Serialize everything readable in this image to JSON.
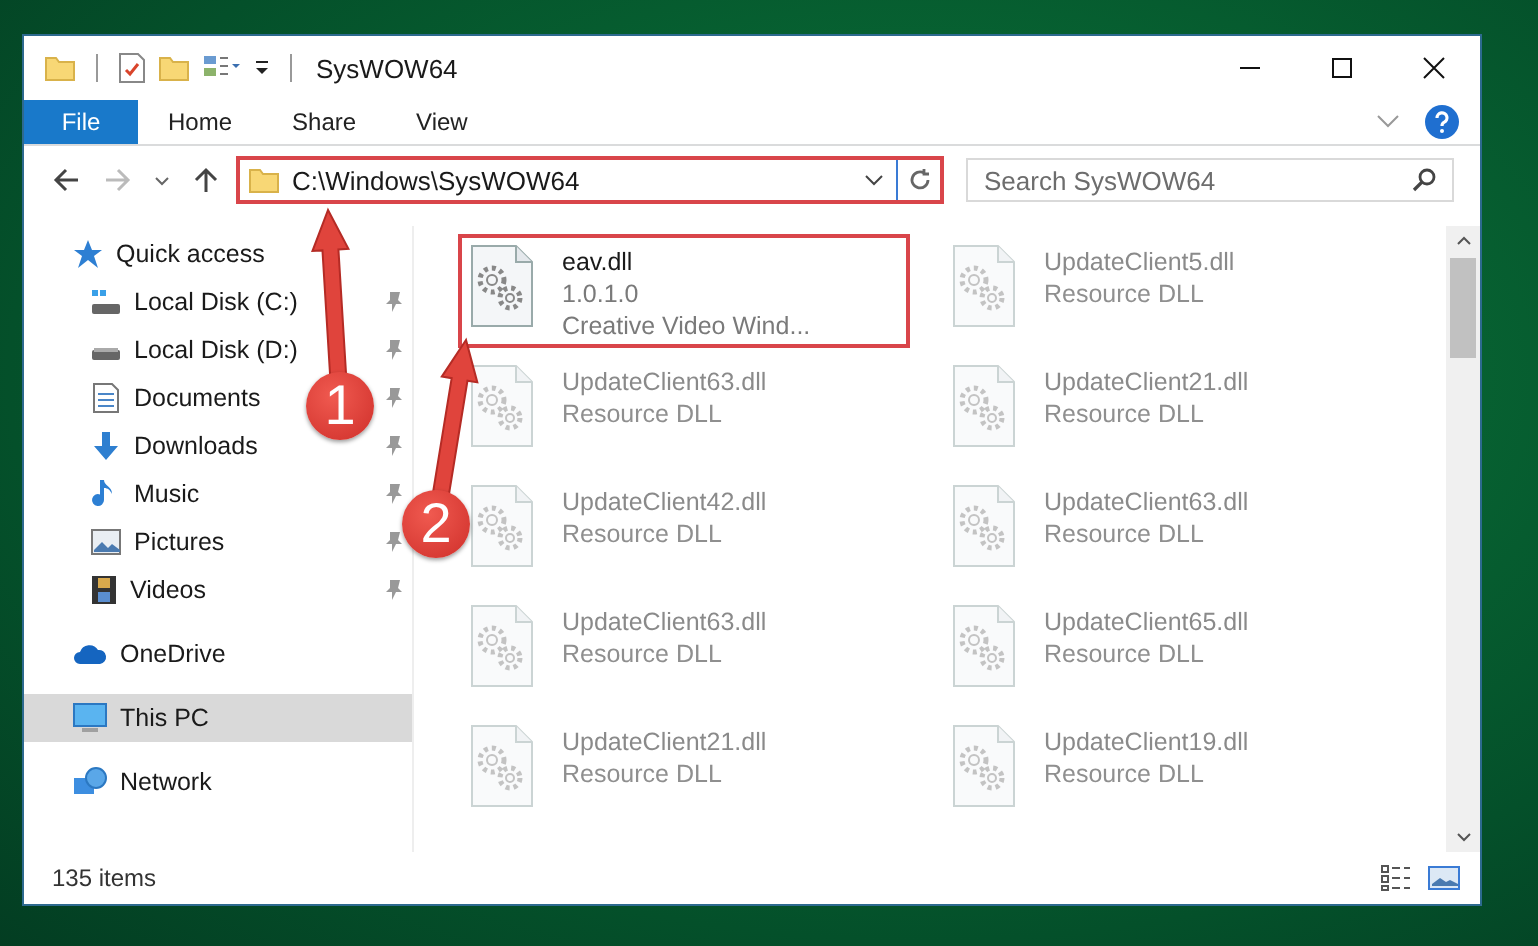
{
  "window": {
    "title": "SysWOW64"
  },
  "ribbon_tabs": [
    {
      "label": "File",
      "kind": "file"
    },
    {
      "label": "Home",
      "kind": "tab"
    },
    {
      "label": "Share",
      "kind": "tab"
    },
    {
      "label": "View",
      "kind": "tab"
    }
  ],
  "address_bar": {
    "path": "C:\\Windows\\SysWOW64",
    "highlighted": true
  },
  "search": {
    "placeholder": "Search SysWOW64"
  },
  "navigation": [
    {
      "label": "Quick access",
      "kind": "quick-access",
      "selected": false,
      "children": [
        {
          "label": "Local Disk (C:)",
          "kind": "system-drive",
          "pinned": true,
          "selected": false
        },
        {
          "label": "Local Disk (D:)",
          "kind": "drive",
          "pinned": true,
          "selected": false
        },
        {
          "label": "Documents",
          "kind": "documents",
          "pinned": true,
          "selected": false
        },
        {
          "label": "Downloads",
          "kind": "downloads",
          "pinned": true,
          "selected": false
        },
        {
          "label": "Music",
          "kind": "music",
          "pinned": true,
          "selected": false
        },
        {
          "label": "Pictures",
          "kind": "pictures",
          "pinned": true,
          "selected": false
        },
        {
          "label": "Videos",
          "kind": "videos",
          "pinned": true,
          "selected": false
        }
      ]
    },
    {
      "label": "OneDrive",
      "kind": "cloud",
      "selected": false
    },
    {
      "label": "This PC",
      "kind": "pc",
      "selected": true
    },
    {
      "label": "Network",
      "kind": "network",
      "selected": false
    }
  ],
  "files": [
    {
      "name": "eav.dll",
      "details": [
        "1.0.1.0",
        "Creative Video Wind..."
      ],
      "blurred": false,
      "highlighted": true
    },
    {
      "name": "UpdateClient5.dll",
      "details": [
        "Resource DLL"
      ],
      "blurred": true,
      "highlighted": false
    },
    {
      "name": "UpdateClient63.dll",
      "details": [
        "Resource DLL"
      ],
      "blurred": true,
      "highlighted": false
    },
    {
      "name": "UpdateClient21.dll",
      "details": [
        "Resource DLL"
      ],
      "blurred": true,
      "highlighted": false
    },
    {
      "name": "UpdateClient42.dll",
      "details": [
        "Resource DLL"
      ],
      "blurred": true,
      "highlighted": false
    },
    {
      "name": "UpdateClient63.dll",
      "details": [
        "Resource DLL"
      ],
      "blurred": true,
      "highlighted": false
    },
    {
      "name": "UpdateClient63.dll",
      "details": [
        "Resource DLL"
      ],
      "blurred": true,
      "highlighted": false
    },
    {
      "name": "UpdateClient65.dll",
      "details": [
        "Resource DLL"
      ],
      "blurred": true,
      "highlighted": false
    },
    {
      "name": "UpdateClient21.dll",
      "details": [
        "Resource DLL"
      ],
      "blurred": true,
      "highlighted": false
    },
    {
      "name": "UpdateClient19.dll",
      "details": [
        "Resource DLL"
      ],
      "blurred": true,
      "highlighted": false
    }
  ],
  "status_bar": {
    "item_count": "135 items"
  },
  "annotations": [
    {
      "number": "1"
    },
    {
      "number": "2"
    }
  ]
}
